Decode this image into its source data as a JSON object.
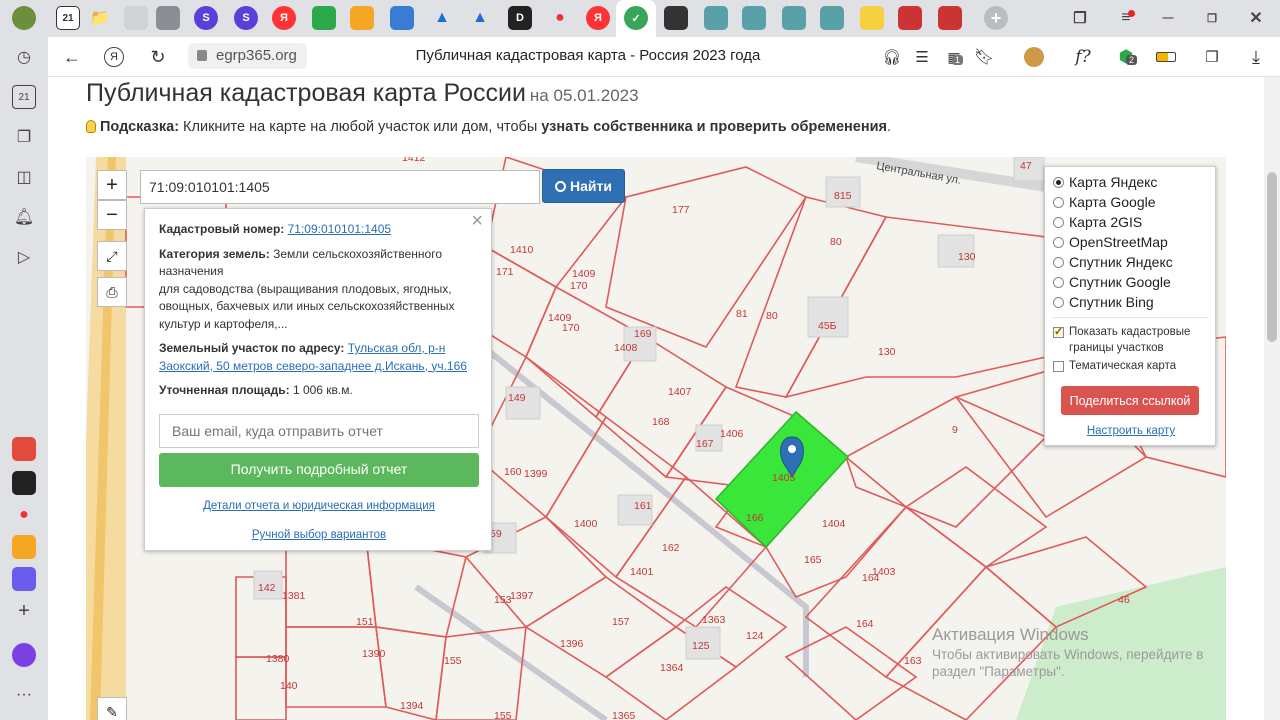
{
  "browser": {
    "address": {
      "domain": "egrp365.org",
      "title": "Публичная кадастровая карта - Россия 2023 года"
    },
    "tab_badge": "21",
    "side_badge": "21",
    "ext_badge_1": "1",
    "ext_badge_2": "2",
    "formula_label": "f?"
  },
  "page": {
    "title": "Публичная кадастровая карта России",
    "date": "на 05.01.2023",
    "hint_label": "Подсказка:",
    "hint_text": " Кликните на карте на любой участок или дом, чтобы ",
    "hint_bold": "узнать собственника и проверить обременения",
    "hint_end": "."
  },
  "map": {
    "search_value": "71:09:010101:1405",
    "find_label": "Найти",
    "zoom_in": "+",
    "zoom_out": "−",
    "street_label": "Центральная ул.",
    "parcel_labels": [
      {
        "t": "1412"
      },
      {
        "t": "177"
      },
      {
        "t": "47"
      },
      {
        "t": "815"
      },
      {
        "t": "80"
      },
      {
        "t": "130"
      },
      {
        "t": "1410"
      },
      {
        "t": "171"
      },
      {
        "t": "1409"
      },
      {
        "t": "170"
      },
      {
        "t": "1409"
      },
      {
        "t": "170"
      },
      {
        "t": "81"
      },
      {
        "t": "80"
      },
      {
        "t": "45Б"
      },
      {
        "t": "169"
      },
      {
        "t": "1408"
      },
      {
        "t": "130"
      },
      {
        "t": "1407"
      },
      {
        "t": "168"
      },
      {
        "t": "167"
      },
      {
        "t": "1406"
      },
      {
        "t": "9"
      },
      {
        "t": "149"
      },
      {
        "t": "160"
      },
      {
        "t": "1399"
      },
      {
        "t": "1405"
      },
      {
        "t": "161"
      },
      {
        "t": "166"
      },
      {
        "t": "1404"
      },
      {
        "t": "1400"
      },
      {
        "t": "59"
      },
      {
        "t": "162"
      },
      {
        "t": "165"
      },
      {
        "t": "1401"
      },
      {
        "t": "1403"
      },
      {
        "t": "164"
      },
      {
        "t": "142"
      },
      {
        "t": "1381"
      },
      {
        "t": "153"
      },
      {
        "t": "1397"
      },
      {
        "t": "157"
      },
      {
        "t": "1363"
      },
      {
        "t": "46"
      },
      {
        "t": "151"
      },
      {
        "t": "1396"
      },
      {
        "t": "125"
      },
      {
        "t": "124"
      },
      {
        "t": "164"
      },
      {
        "t": "1380"
      },
      {
        "t": "1390"
      },
      {
        "t": "155"
      },
      {
        "t": "1364"
      },
      {
        "t": "163"
      },
      {
        "t": "140"
      },
      {
        "t": "1394"
      },
      {
        "t": "155"
      },
      {
        "t": "1365"
      }
    ]
  },
  "info": {
    "cad_label": "Кадастровый номер:",
    "cad_value": "71:09:010101:1405",
    "cat_label": "Категория земель:",
    "cat_value_1": "Земли сельскохозяйственного",
    "cat_value_2": "назначения",
    "cat_use_1": "для садоводства (выращивания плодовых, ягодных,",
    "cat_use_2": "овощных, бахчевых или иных сельскохозяйственных",
    "cat_use_3": "культур и картофеля,...",
    "addr_label": "Земельный участок по адресу:",
    "addr_value_1": "Тульская обл, р-н",
    "addr_value_2": "Заокский, 50 метров северо-западнее д.Искань, уч.166",
    "area_label": "Уточненная площадь:",
    "area_value": "1 006 кв.м.",
    "email_placeholder": "Ваш email, куда отправить отчет",
    "report_btn": "Получить подробный отчет",
    "details_link": "Детали отчета и юридическая информация",
    "manual_link": "Ручной выбор вариантов"
  },
  "layers": {
    "options": [
      "Карта Яндекс",
      "Карта Google",
      "Карта 2GIS",
      "OpenStreetMap",
      "Спутник Яндекс",
      "Спутник Google",
      "Спутник Bing"
    ],
    "selected": "Карта Яндекс",
    "show_borders_1": "Показать кадастровые",
    "show_borders_2": "границы участков",
    "thematic": "Тематическая карта",
    "share_btn": "Поделиться ссылкой",
    "configure": "Настроить карту"
  },
  "watermark": {
    "title": "Активация Windows",
    "line1": "Чтобы активировать Windows, перейдите в",
    "line2": "раздел \"Параметры\"."
  },
  "colors": {
    "accent_blue": "#2f6fb4",
    "green_btn": "#5cb85c",
    "red_btn": "#d9534f",
    "parcel_red": "#e05a5a",
    "selected_parcel": "#39e639"
  }
}
